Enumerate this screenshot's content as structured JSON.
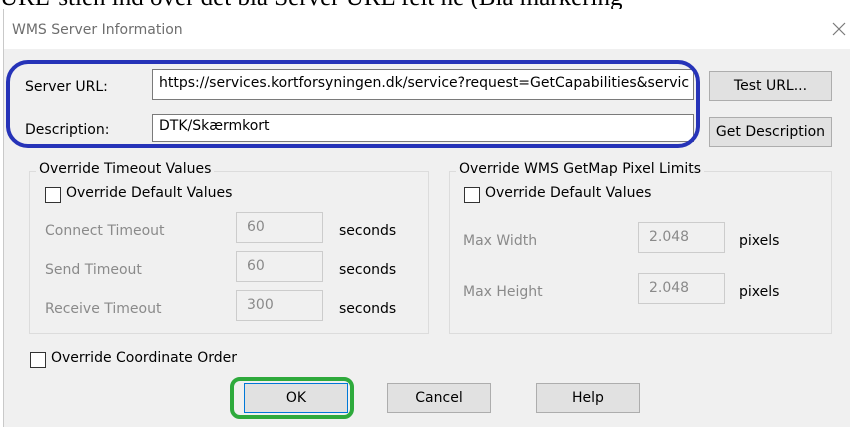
{
  "background_text": "URL-stien ind over det blå Server URL felt ne (Bla markering",
  "dialog": {
    "title": "WMS Server Information",
    "close_icon": "close-icon"
  },
  "server": {
    "url_label": "Server URL:",
    "url_value": "https://services.kortforsyningen.dk/service?request=GetCapabilities&servic",
    "test_button": "Test URL...",
    "description_label": "Description:",
    "description_value": "DTK/Skærmkort",
    "get_description_button": "Get Description"
  },
  "timeout": {
    "group_title": "Override Timeout Values",
    "override_label": "Override Default Values",
    "override_checked": false,
    "connect_label": "Connect Timeout",
    "connect_value": "60",
    "send_label": "Send Timeout",
    "send_value": "60",
    "receive_label": "Receive Timeout",
    "receive_value": "300",
    "unit": "seconds"
  },
  "pixel_limits": {
    "group_title": "Override WMS GetMap Pixel Limits",
    "override_label": "Override Default Values",
    "override_checked": false,
    "max_width_label": "Max Width",
    "max_width_value": "2.048",
    "max_height_label": "Max Height",
    "max_height_value": "2.048",
    "unit": "pixels"
  },
  "coordinate_order": {
    "label": "Override Coordinate Order",
    "checked": false
  },
  "buttons": {
    "ok": "OK",
    "cancel": "Cancel",
    "help": "Help"
  },
  "colors": {
    "blue_highlight": "#2633b8",
    "green_highlight": "#2eaa3c"
  }
}
